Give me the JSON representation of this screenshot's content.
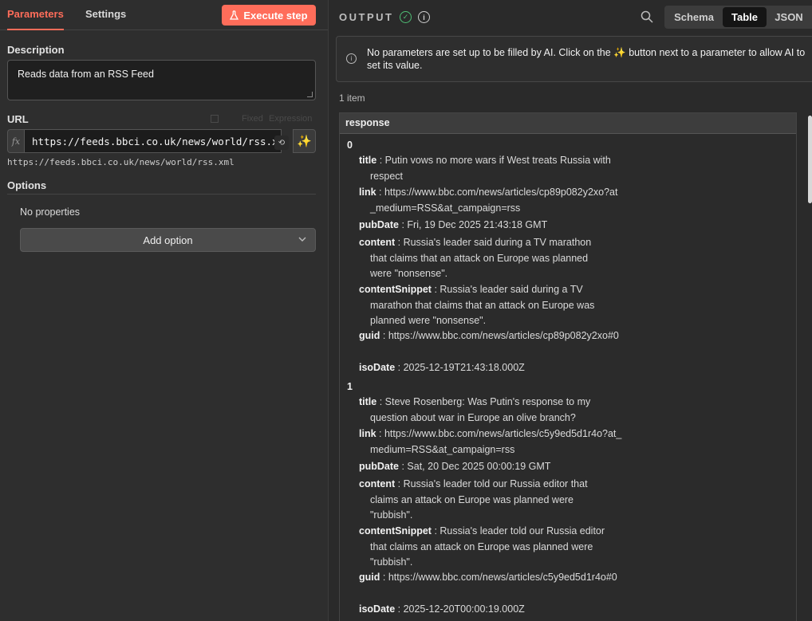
{
  "left_panel": {
    "tabs": [
      {
        "label": "Parameters",
        "active": true
      },
      {
        "label": "Settings",
        "active": false
      }
    ],
    "execute_button": "Execute step",
    "description": {
      "label": "Description",
      "value": "Reads data from an RSS Feed"
    },
    "url": {
      "label": "URL",
      "mode_fixed": "Fixed",
      "mode_expression": "Expression",
      "fx_label": "fx",
      "value": "https://feeds.bbci.co.uk/news/world/rss.xml",
      "hint": "https://feeds.bbci.co.uk/news/world/rss.xml"
    },
    "options": {
      "label": "Options",
      "empty_text": "No properties",
      "add_button": "Add option"
    }
  },
  "right_panel": {
    "title": "OUTPUT",
    "view_modes": [
      {
        "label": "Schema",
        "active": false
      },
      {
        "label": "Table",
        "active": true
      },
      {
        "label": "JSON",
        "active": false
      }
    ],
    "notice": "No parameters are set up to be filled by AI. Click on the ✨ button next to a parameter to allow AI to set its value.",
    "item_count": "1 item",
    "table": {
      "column": "response",
      "records": [
        {
          "index": "0",
          "fields": [
            {
              "key": "title",
              "value": "Putin vows no more wars if West treats Russia with respect"
            },
            {
              "key": "link",
              "value": "https://www.bbc.com/news/articles/cp89p082y2xo?at_medium=RSS&at_campaign=rss"
            },
            {
              "key": "pubDate",
              "value": "Fri, 19 Dec 2025 21:43:18 GMT"
            },
            {
              "key": "content",
              "value": "Russia's leader said during a TV marathon that claims that an attack on Europe was planned were \"nonsense\"."
            },
            {
              "key": "contentSnippet",
              "value": "Russia's leader said during a TV marathon that claims that an attack on Europe was planned were \"nonsense\"."
            },
            {
              "key": "guid",
              "value": "https://www.bbc.com/news/articles/cp89p082y2xo#0"
            },
            {
              "key": "isoDate",
              "value": "2025-12-19T21:43:18.000Z"
            }
          ]
        },
        {
          "index": "1",
          "fields": [
            {
              "key": "title",
              "value": "Steve Rosenberg: Was Putin's response to my question about war in Europe an olive branch?"
            },
            {
              "key": "link",
              "value": "https://www.bbc.com/news/articles/c5y9ed5d1r4o?at_medium=RSS&at_campaign=rss"
            },
            {
              "key": "pubDate",
              "value": "Sat, 20 Dec 2025 00:00:19 GMT"
            },
            {
              "key": "content",
              "value": "Russia's leader told our Russia editor that claims an attack on Europe was planned were \"rubbish\"."
            },
            {
              "key": "contentSnippet",
              "value": "Russia's leader told our Russia editor that claims an attack on Europe was planned were \"rubbish\"."
            },
            {
              "key": "guid",
              "value": "https://www.bbc.com/news/articles/c5y9ed5d1r4o#0"
            },
            {
              "key": "isoDate",
              "value": "2025-12-20T00:00:19.000Z"
            }
          ]
        }
      ]
    }
  },
  "colors": {
    "accent": "#ff6d5a",
    "success": "#4fbf75"
  },
  "icons": [
    "flask-icon",
    "fx-icon",
    "reset-icon",
    "sparkle-icon",
    "chevron-down-icon",
    "check-circle-icon",
    "info-icon",
    "search-icon"
  ]
}
